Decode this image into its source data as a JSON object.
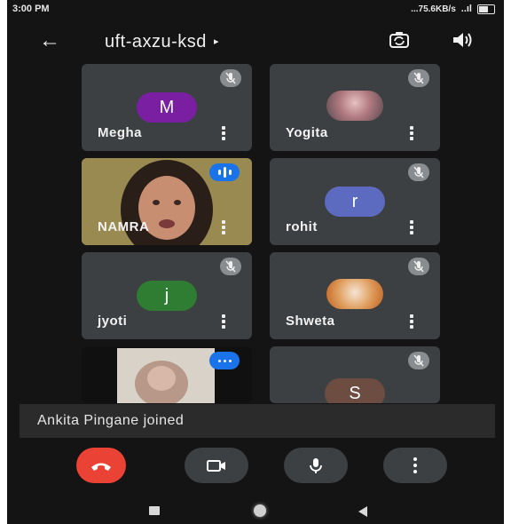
{
  "status_bar": {
    "time": "3:00 PM",
    "network_speed": "...75.6KB/s",
    "signal": "..ıl",
    "battery": "battery-icon"
  },
  "header": {
    "title": "uft-axzu-ksd",
    "caret": "▸"
  },
  "participants": [
    {
      "name": "Megha",
      "initial": "M",
      "avatar_color": "#7b1fa2",
      "muted": true
    },
    {
      "name": "Yogita",
      "initial": "",
      "avatar_color": "#c9a0a8",
      "muted": true
    },
    {
      "name": "NAMRA",
      "initial": "",
      "avatar_color": "",
      "muted": false,
      "speaking": true
    },
    {
      "name": "rohit",
      "initial": "r",
      "avatar_color": "#5c6bc0",
      "muted": true
    },
    {
      "name": "jyoti",
      "initial": "j",
      "avatar_color": "#2e7d32",
      "muted": true
    },
    {
      "name": "Shweta",
      "initial": "",
      "avatar_color": "#d98a3a",
      "muted": true
    },
    {
      "name": "",
      "initial": "",
      "avatar_color": "",
      "muted": false,
      "speaking": true
    },
    {
      "name": "",
      "initial": "S",
      "avatar_color": "#6d4c41",
      "muted": true
    }
  ],
  "toast": {
    "message": "Ankita Pingane joined"
  },
  "controls": {
    "end_call_color": "#ea4335",
    "control_bg": "#3c4043"
  }
}
